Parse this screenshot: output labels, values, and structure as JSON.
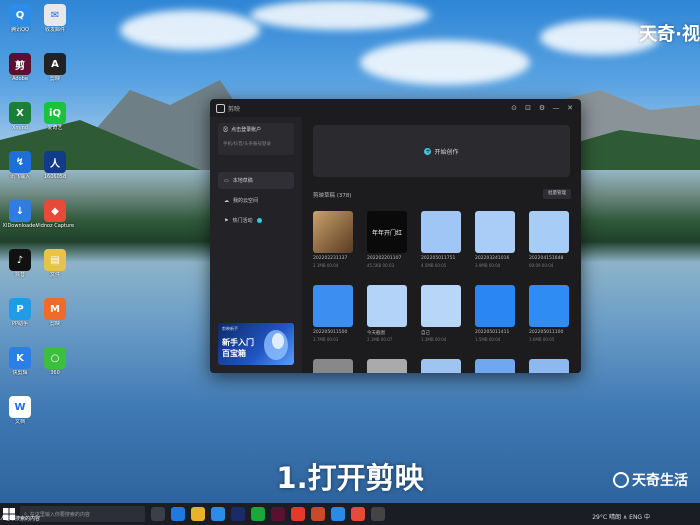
{
  "desktop": {
    "icons": [
      {
        "label": "腾讯QQ",
        "color": "#2b8de8",
        "glyph": "Q"
      },
      {
        "label": "收发邮件",
        "color": "#e8e8e8",
        "glyph": "✉"
      },
      {
        "label": "Adobe",
        "color": "#5a1030",
        "glyph": "剪"
      },
      {
        "label": "剪映",
        "color": "#222222",
        "glyph": "A"
      },
      {
        "label": "Xmind",
        "color": "#1b7f3a",
        "glyph": "X"
      },
      {
        "label": "爱奇艺",
        "color": "#19c43a",
        "glyph": "iQ"
      },
      {
        "label": "讯飞输入",
        "color": "#1e6fd9",
        "glyph": "↯"
      },
      {
        "label": "1606058",
        "color": "#123b8a",
        "glyph": "人"
      },
      {
        "label": "XIDownloader",
        "color": "#2f7de0",
        "glyph": "↓"
      },
      {
        "label": "Vidnoz Capture",
        "color": "#e84a3a",
        "glyph": "◆"
      },
      {
        "label": "抖音",
        "color": "#111111",
        "glyph": "♪"
      },
      {
        "label": "文件",
        "color": "#e8c34a",
        "glyph": "▤"
      },
      {
        "label": "PP助手",
        "color": "#1f9be8",
        "glyph": "P"
      },
      {
        "label": "剪映",
        "color": "#f06a2a",
        "glyph": "M"
      },
      {
        "label": "快剪辑",
        "color": "#2a7fe8",
        "glyph": "K"
      },
      {
        "label": "360",
        "color": "#3cbf3c",
        "glyph": "○"
      },
      {
        "label": "文档",
        "color": "#ffffff",
        "glyph": "W"
      }
    ],
    "watermark_top": "天奇·视"
  },
  "app": {
    "title": "剪映",
    "login": {
      "primary": "点击登录账户",
      "secondary": "手机/抖音/头条账号登录"
    },
    "nav": [
      {
        "label": "本地草稿",
        "icon": "folder-icon",
        "active": true
      },
      {
        "label": "我的云空间",
        "icon": "cloud-icon",
        "active": false
      },
      {
        "label": "热门活动",
        "icon": "flag-icon",
        "active": false
      }
    ],
    "banner": {
      "small": "剪映新手",
      "line1": "新手入门",
      "line2": "百宝箱"
    },
    "create_label": "开始创作",
    "drafts_title": "剪映草稿 (378)",
    "manage_label": "批量管理",
    "drafts": [
      {
        "name": "202202231137",
        "meta": "2.1MB 00:04",
        "color": "#7a5a3a"
      },
      {
        "name": "202202201107",
        "meta": "45.5KB 00:03",
        "color": "#0a0a0a"
      },
      {
        "name": "202205011751",
        "meta": "4.5MB 00:05",
        "color": "#9fc6f5"
      },
      {
        "name": "202203241016",
        "meta": "3.9MB 00:04",
        "color": "#a9cdf7"
      },
      {
        "name": "202204151648",
        "meta": "00:09 00:04",
        "color": "#a7ccf6"
      },
      {
        "name": "202205011500",
        "meta": "3.7MB 00:03",
        "color": "#3c8ff0"
      },
      {
        "name": "今天截图",
        "meta": "2.1MB 00:07",
        "color": "#b3d3f8"
      },
      {
        "name": "自己",
        "meta": "1.3MB 00:04",
        "color": "#b8d6f8"
      },
      {
        "name": "202205011411",
        "meta": "1.5MB 00:04",
        "color": "#2a86f2"
      },
      {
        "name": "202205011100",
        "meta": "3.6MB 00:05",
        "color": "#2f8cf3"
      }
    ],
    "draft_overlay_text": "年年开门红"
  },
  "subtitle": "1.打开剪映",
  "brand": "天奇生活",
  "taskbar": {
    "search_placeholder": "在这里输入你要搜索的内容",
    "left_text": "人在哪搜索的内容",
    "tray": "29°C 晴朗 ∧ ENG 中"
  }
}
